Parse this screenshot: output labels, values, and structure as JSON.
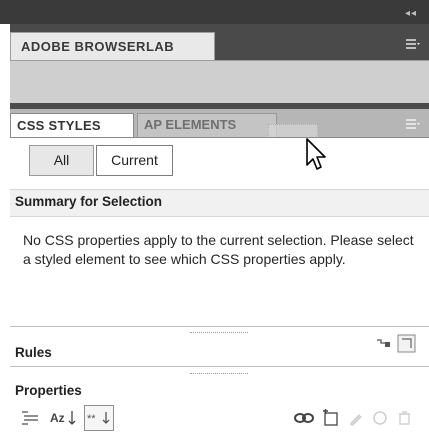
{
  "browserlab": {
    "tab_label": "ADOBE BROWSERLAB"
  },
  "css_panel": {
    "tabs": [
      {
        "label": "CSS STYLES",
        "active": true
      },
      {
        "label": "AP ELEMENTS",
        "active": false
      }
    ],
    "mode_buttons": {
      "all_label": "All",
      "current_label": "Current",
      "selected": "Current"
    },
    "summary": {
      "title": "Summary for Selection",
      "message": "No CSS properties apply to the current selection.  Please select a styled element to see which CSS properties apply."
    },
    "rules": {
      "title": "Rules"
    },
    "properties": {
      "title": "Properties"
    }
  },
  "icons": {
    "panel_menu": "panel-menu-icon",
    "show_category_view": "category-view-icon",
    "show_alphabetical": "alphabetical-view-icon",
    "show_set_properties": "set-properties-icon",
    "attach_style_sheet": "attach-stylesheet-icon",
    "new_css_rule": "new-rule-icon",
    "edit_rule": "edit-rule-icon",
    "disable_css": "disable-css-icon",
    "delete_css": "delete-css-icon"
  },
  "colors": {
    "panel_dark": "#4a4a4a",
    "tab_active": "#ffffff",
    "tab_inactive": "#c4c4c4"
  }
}
